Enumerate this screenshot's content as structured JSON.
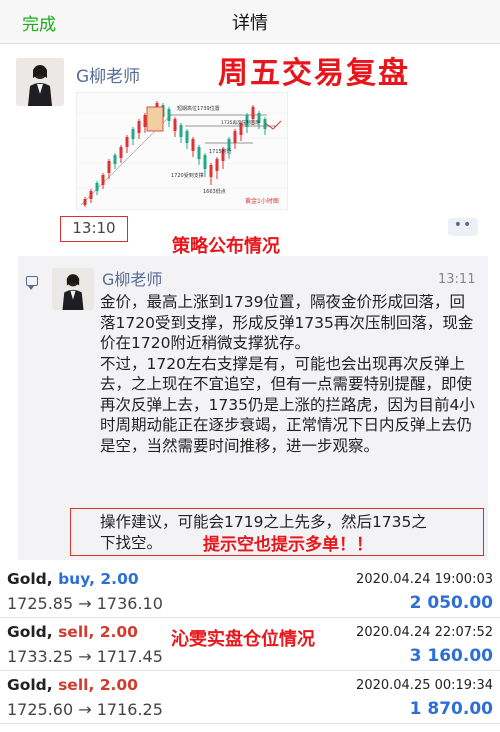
{
  "nav": {
    "done": "完成",
    "title": "详情"
  },
  "post": {
    "author": "G柳老师",
    "overlay_title": "周五交易复盘",
    "time": "13:10",
    "strategy_label": "策略公布情况",
    "more": "••",
    "chart": {
      "caption": "黄金1小时图",
      "annotations": [
        "短期高位1739位置",
        "1720受到支撑",
        "1735再次压制回落",
        "1715附近",
        "1663低点"
      ]
    }
  },
  "comment": {
    "author": "G柳老师",
    "time": "13:11",
    "paragraph1": "金价，最高上涨到1739位置，隔夜金价形成回落，回落1720受到支撑，形成反弹1735再次压制回落，现金价在1720附近稍微支撑犹存。",
    "paragraph2": "不过，1720左右支撑是有，可能也会出现再次反弹上去，之上现在不宜追空，但有一点需要特别提醒，即使再次反弹上去，1735仍是上涨的拦路虎，因为目前4小时周期动能正在逐步衰竭，正常情况下日内反弹上去仍是空，当然需要时间推移，进一步观察。",
    "advice": "操作建议，可能会1719之上先多，然后1735之下找空。",
    "advice_highlight": "提示空也提示多单！！"
  },
  "positions_label": "沁雯实盘仓位情况",
  "trades": [
    {
      "symbol": "Gold,",
      "direction": "buy, 2.00",
      "date": "2020.04.24 19:00:03",
      "prices": "1725.85 → 1736.10",
      "profit": "2 050.00"
    },
    {
      "symbol": "Gold,",
      "direction": "sell, 2.00",
      "date": "2020.04.24 22:07:52",
      "prices": "1733.25 → 1717.45",
      "profit": "3 160.00"
    },
    {
      "symbol": "Gold,",
      "direction": "sell, 2.00",
      "date": "2020.04.25 00:19:34",
      "prices": "1725.60 → 1716.25",
      "profit": "1 870.00"
    }
  ],
  "colors": {
    "accent_green": "#1aad19",
    "link_blue": "#576b95",
    "highlight_red": "#e8161b",
    "buy_blue": "#2e6fd6",
    "sell_red": "#d33b2c"
  }
}
